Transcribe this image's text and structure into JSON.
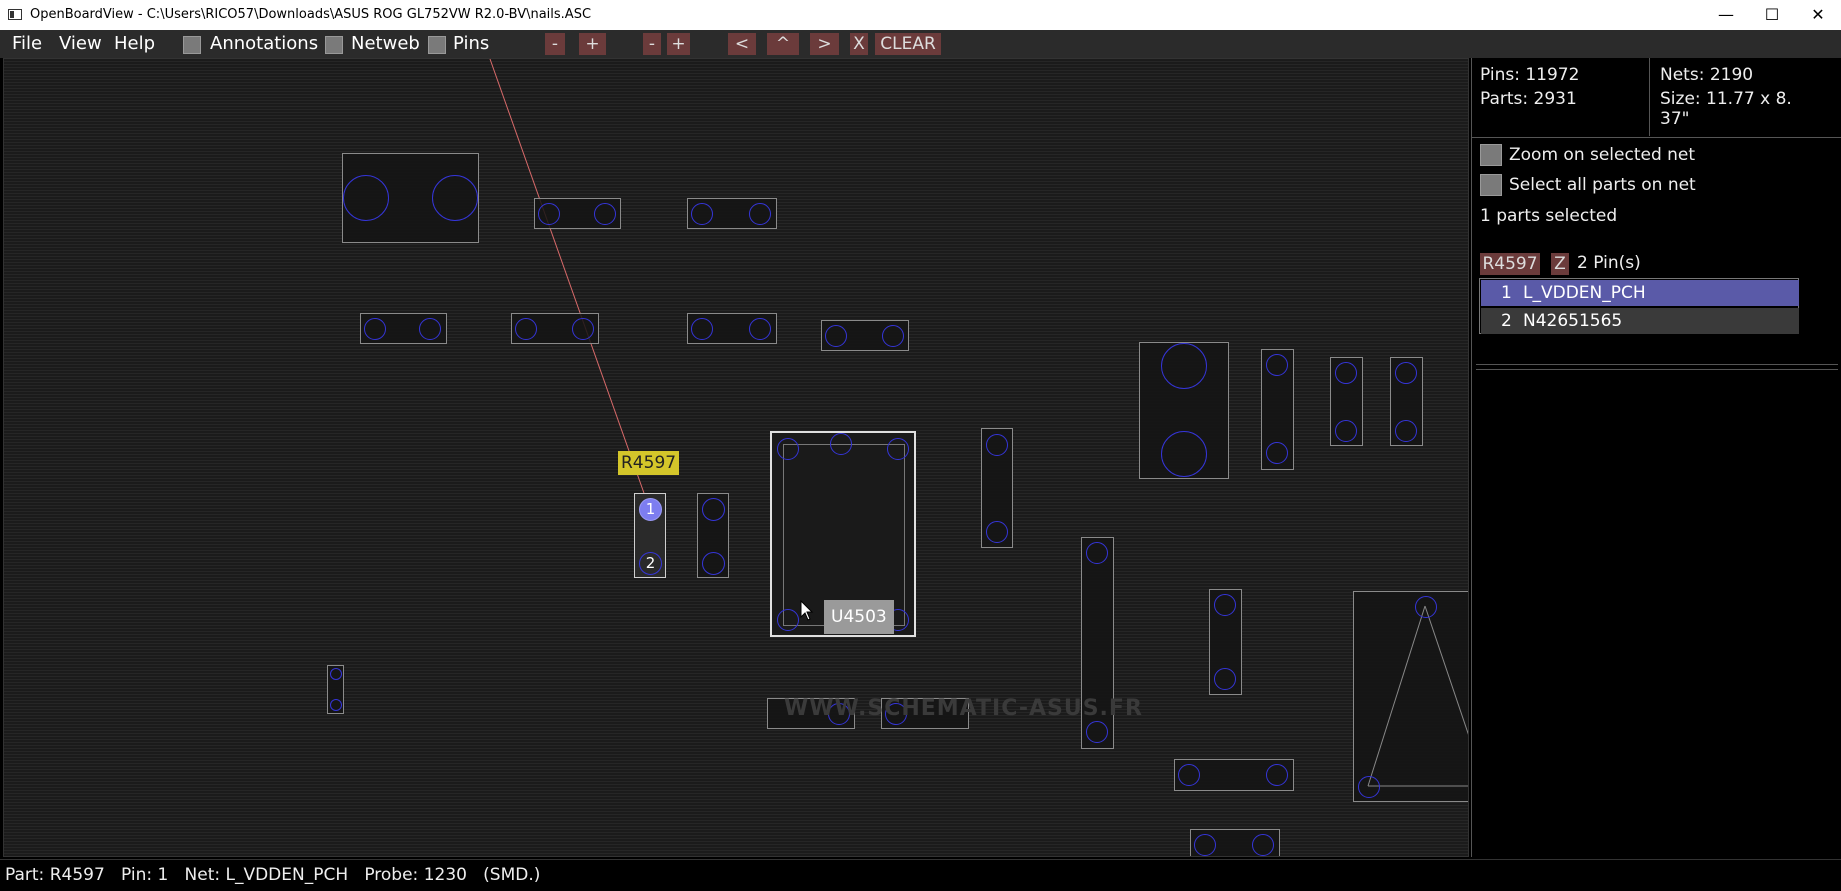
{
  "window": {
    "title": "OpenBoardView - C:\\Users\\RICO57\\Downloads\\ASUS ROG GL752VW R2.0-BV\\nails.ASC",
    "minimize_symbol": "—",
    "maximize_symbol": "☐",
    "close_symbol": "✕"
  },
  "menu": {
    "file": "File",
    "view": "View",
    "help": "Help",
    "annotations": "Annotations",
    "netweb": "Netweb",
    "pins": "Pins"
  },
  "toolbar": {
    "zoom_out": "-",
    "zoom_in": "+",
    "minus2": "-",
    "plus2": "+",
    "prev": "<",
    "up": "^",
    "next": ">",
    "x": "X",
    "clear": "CLEAR"
  },
  "board": {
    "selected_part_label": "R4597",
    "hover_part_label": "U4503",
    "pin1": "1",
    "pin2": "2",
    "watermark": "WWW.SCHEMATIC-ASUS.FR"
  },
  "info": {
    "pins": "Pins: 11972",
    "nets": "Nets: 2190",
    "parts": "Parts: 2931",
    "size": "Size: 11.77 x 8.",
    "size2": "37\"",
    "zoom_on_net": "Zoom on selected net",
    "select_all_on_net": "Select all parts on net",
    "parts_selected": "1 parts selected",
    "part_name": "R4597",
    "z_button": "Z",
    "pin_count": "2 Pin(s)",
    "pin_rows": [
      {
        "num": "1",
        "net": "L_VDDEN_PCH"
      },
      {
        "num": "2",
        "net": "N42651565"
      }
    ]
  },
  "status": {
    "text": "Part: R4597   Pin: 1   Net: L_VDDEN_PCH   Probe: 1230   (SMD.)"
  },
  "colors": {
    "pin_outline": "#3535d8",
    "part_outline": "#8a8a8a",
    "button_bg": "#6b3b3b",
    "selected_row": "#5a5aa8",
    "label_yellow": "#d4c62a"
  }
}
